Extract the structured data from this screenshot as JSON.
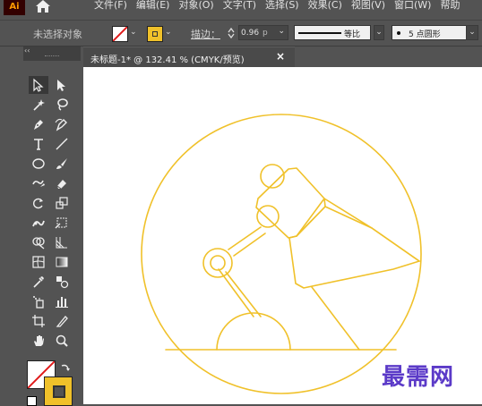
{
  "app": {
    "logo": "Ai"
  },
  "menu": {
    "items": [
      "文件(F)",
      "编辑(E)",
      "对象(O)",
      "文字(T)",
      "选择(S)",
      "效果(C)",
      "视图(V)",
      "窗口(W)",
      "帮助"
    ]
  },
  "control_bar": {
    "selection_status": "未选择对象",
    "fill": {
      "state": "none",
      "color": "#ffffff"
    },
    "stroke": {
      "color": "#f0c12a"
    },
    "stroke_label": "描边：",
    "stroke_weight": "0.96",
    "stroke_unit": "p",
    "profile_label": "等比",
    "brush_label": "5 点圆形"
  },
  "document_tab": {
    "title": "未标题-1* @ 132.41 % (CMYK/预览)",
    "close_glyph": "×"
  },
  "tools_panel": {
    "collapse_glyph": "‹‹",
    "tools": [
      "selection-tool",
      "direct-selection-tool",
      "magic-wand-tool",
      "lasso-tool",
      "pen-tool",
      "curvature-tool",
      "type-tool",
      "line-segment-tool",
      "ellipse-tool",
      "paintbrush-tool",
      "shaper-tool",
      "eraser-tool",
      "rotate-tool",
      "scale-tool",
      "puppet-warp-tool",
      "free-transform-tool",
      "shape-builder-tool",
      "perspective-grid-tool",
      "mesh-tool",
      "gradient-tool",
      "eyedropper-tool",
      "blend-tool",
      "symbol-sprayer-tool",
      "column-graph-tool",
      "artboard-tool",
      "slice-tool",
      "hand-tool",
      "zoom-tool"
    ]
  },
  "artwork": {
    "stroke_color": "#f0c12a"
  },
  "watermark": {
    "text": "最需网",
    "color": "#5b3ac8"
  }
}
